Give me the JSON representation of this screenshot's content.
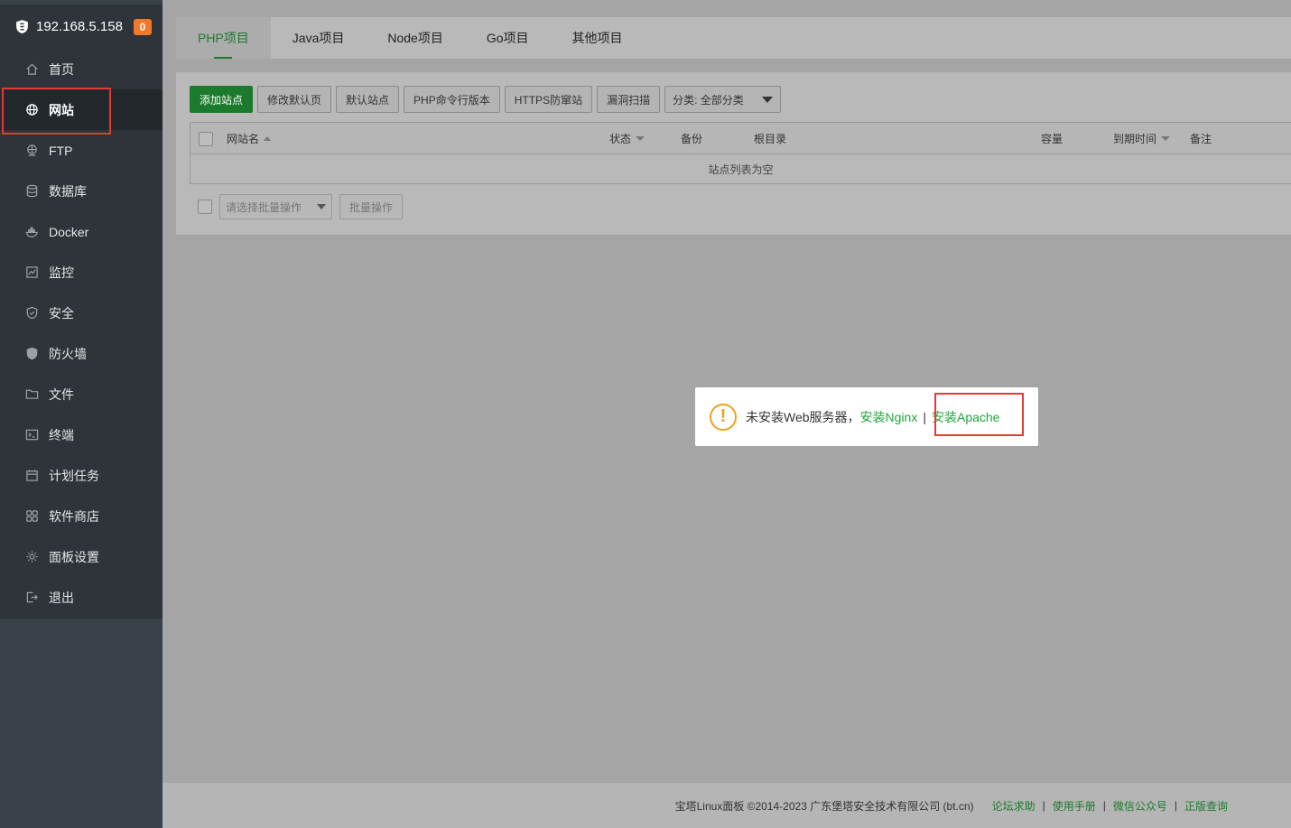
{
  "sidebar": {
    "host": "192.168.5.158",
    "badge": "0",
    "items": [
      {
        "label": "首页",
        "icon": "home-icon"
      },
      {
        "label": "网站",
        "icon": "globe-icon"
      },
      {
        "label": "FTP",
        "icon": "ftp-icon"
      },
      {
        "label": "数据库",
        "icon": "database-icon"
      },
      {
        "label": "Docker",
        "icon": "docker-icon"
      },
      {
        "label": "监控",
        "icon": "monitor-icon"
      },
      {
        "label": "安全",
        "icon": "shield-check-icon"
      },
      {
        "label": "防火墙",
        "icon": "firewall-icon"
      },
      {
        "label": "文件",
        "icon": "folder-icon"
      },
      {
        "label": "终端",
        "icon": "terminal-icon"
      },
      {
        "label": "计划任务",
        "icon": "calendar-icon"
      },
      {
        "label": "软件商店",
        "icon": "apps-icon"
      },
      {
        "label": "面板设置",
        "icon": "gear-icon"
      },
      {
        "label": "退出",
        "icon": "logout-icon"
      }
    ]
  },
  "tabs": [
    "PHP项目",
    "Java项目",
    "Node项目",
    "Go项目",
    "其他项目"
  ],
  "toolbar": {
    "add_site": "添加站点",
    "edit_default_page": "修改默认页",
    "default_site": "默认站点",
    "php_cli": "PHP命令行版本",
    "https_anti": "HTTPS防窜站",
    "vuln_scan": "漏洞扫描",
    "category": "分类: 全部分类"
  },
  "table": {
    "columns": [
      "网站名",
      "状态",
      "备份",
      "根目录",
      "容量",
      "到期时间",
      "备注"
    ],
    "empty": "站点列表为空"
  },
  "batch": {
    "placeholder": "请选择批量操作",
    "button": "批量操作"
  },
  "dialog": {
    "message": "未安装Web服务器，",
    "install_nginx": "安装Nginx",
    "separator": "|",
    "install_apache": "安装Apache"
  },
  "footer": {
    "copyright": "宝塔Linux面板 ©2014-2023 广东堡塔安全技术有限公司 (bt.cn)",
    "links": [
      "论坛求助",
      "使用手册",
      "微信公众号",
      "正版查询"
    ]
  },
  "colors": {
    "accent": "#1c7a2c",
    "badge": "#f0792c",
    "highlight": "#e53935",
    "link": "#20a53a"
  }
}
